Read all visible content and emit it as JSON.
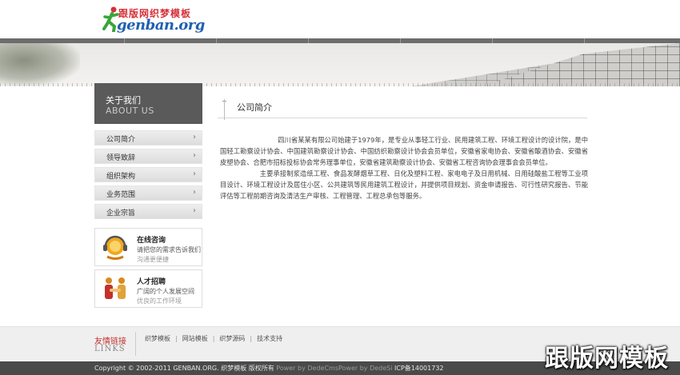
{
  "header": {
    "logo_cn": "跟版网织梦模板",
    "logo_en": "genban.org"
  },
  "sidebar": {
    "title_cn": "关于我们",
    "title_en": "ABOUT US",
    "items": [
      {
        "label": "公司简介",
        "chevron": "›"
      },
      {
        "label": "领导致辞",
        "chevron": "›"
      },
      {
        "label": "组织架构",
        "chevron": "›"
      },
      {
        "label": "业务范围",
        "chevron": "›"
      },
      {
        "label": "企业宗旨",
        "chevron": "›"
      }
    ],
    "cards": [
      {
        "title": "在线咨询",
        "line1": "请把您的需求告诉我们",
        "line2": "沟通更便捷",
        "icon": "headset-icon"
      },
      {
        "title": "人才招聘",
        "line1": "广阔的个人发展空间",
        "line2": "优良的工作环境",
        "icon": "handshake-icon"
      }
    ]
  },
  "main": {
    "title": "公司简介",
    "paragraphs": [
      "四川省某某有限公司始建于1979年，是专业从事轻工行业、民用建筑工程、环境工程设计的设计院，是中国轻工勘察设计协会、中国建筑勘察设计协会、中国纺织勘察设计协会会员单位，安徽省家电协会、安徽省酿酒协会、安徽省皮塑协会、合肥市招标投标协会常务理事单位，安徽省建筑勘察设计协会、安徽省工程咨询协会理事会会员单位。",
      "主要承接制浆造纸工程、食品发酵烟草工程、日化及塑料工程、家电电子及日用机械、日用硅酸盐工程等工业项目设计、环境工程设计及居住小区、公共建筑等民用建筑工程设计，并提供项目规划、资金申请报告、可行性研究报告、节能评估等工程前期咨询及清洁生产审核、工程管理、工程总承包等服务。"
    ]
  },
  "footer": {
    "links_cn": "友情链接",
    "links_en": "LINKS",
    "links": [
      "织梦模板",
      "网站模板",
      "织梦源码",
      "技术支持"
    ],
    "copyright": "Copyright © 2002-2011 GENBAN.ORG. 织梦模板 版权所有",
    "power": "Power by DedeCmsPower by DedeSi",
    "icp": "ICP备14001732"
  },
  "watermark": "跟版网模板",
  "colors": {
    "accent_red": "#c0322b",
    "logo_blue": "#1f5fb0",
    "sidebar_dark": "#5a5a5a"
  }
}
